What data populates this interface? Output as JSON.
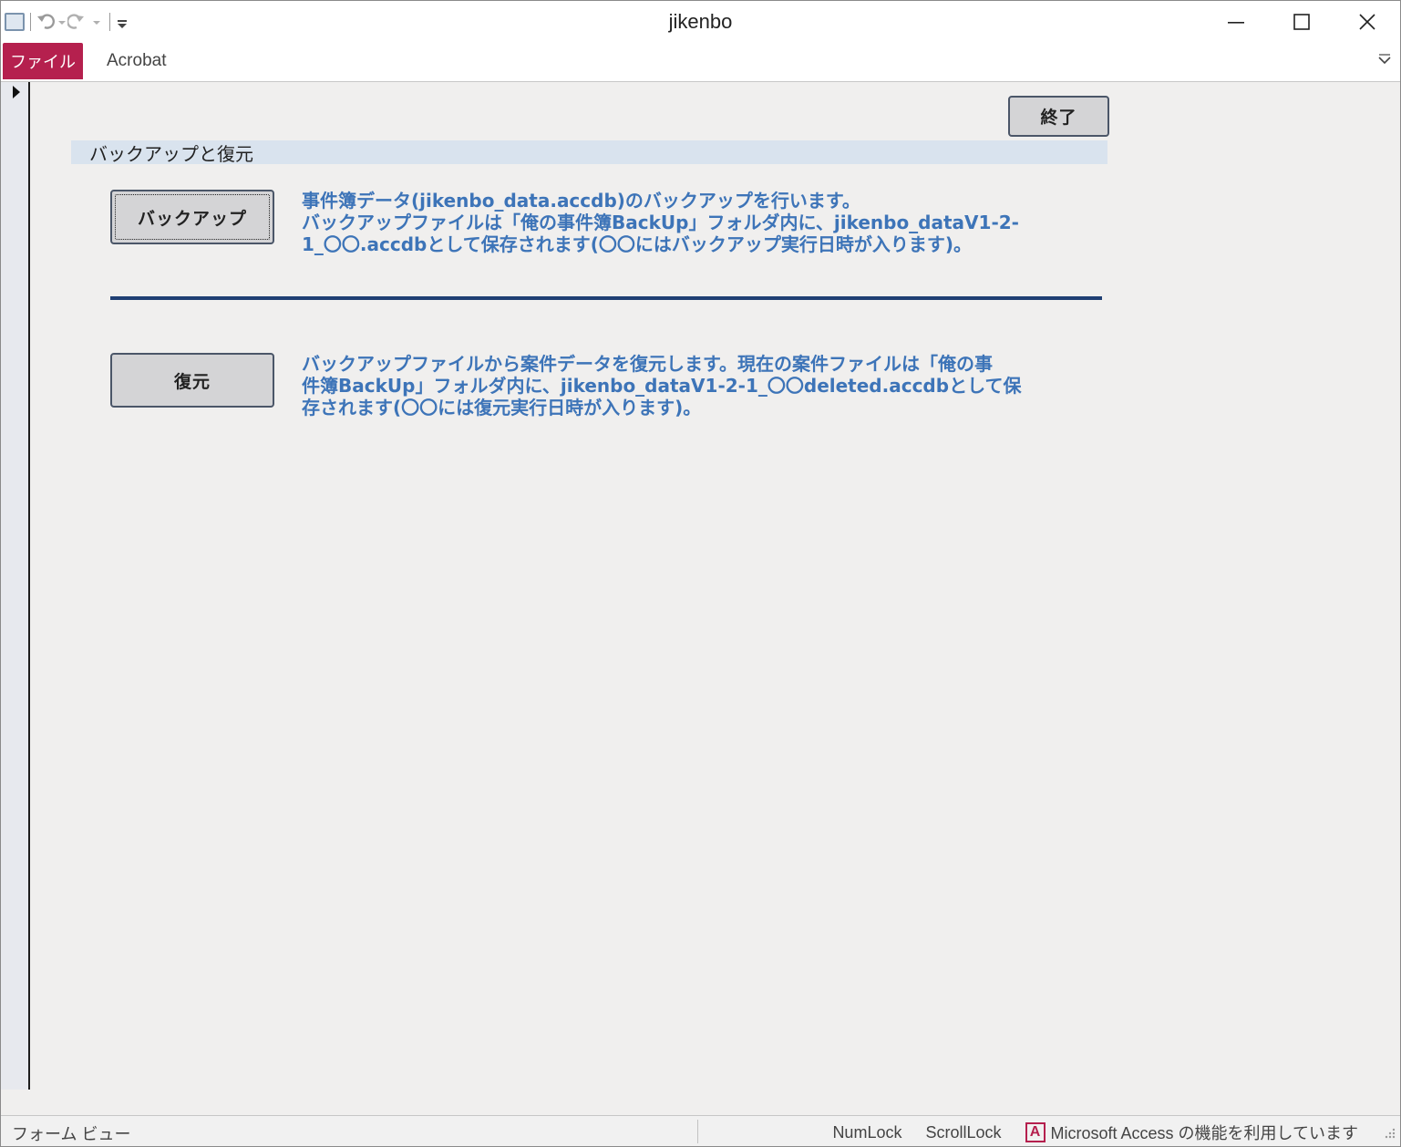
{
  "window": {
    "title": "jikenbo"
  },
  "ribbon": {
    "tabs": [
      {
        "label": "ファイル",
        "active": true
      },
      {
        "label": "Acrobat",
        "active": false
      }
    ]
  },
  "form": {
    "exit_button": "終了",
    "section_title": "バックアップと復元",
    "backup": {
      "button_label": "バックアップ",
      "description": [
        "事件簿データ(jikenbo_data.accdb)のバックアップを行います。",
        "バックアップファイルは「俺の事件簿BackUp」フォルダ内に、jikenbo_dataV1-2-",
        "1_〇〇.accdbとして保存されます(〇〇にはバックアップ実行日時が入ります)。"
      ]
    },
    "restore": {
      "button_label": "復元",
      "description": [
        "バックアップファイルから案件データを復元します。現在の案件ファイルは「俺の事",
        "件簿BackUp」フォルダ内に、jikenbo_dataV1-2-1_〇〇deleted.accdbとして保",
        "存されます(〇〇には復元実行日時が入ります)。"
      ]
    }
  },
  "statusbar": {
    "view": "フォーム ビュー",
    "numlock": "NumLock",
    "scrolllock": "ScrollLock",
    "access_notice": "Microsoft Access の機能を利用しています"
  },
  "colors": {
    "file_tab": "#b5204e",
    "description_text": "#3d74b8",
    "divider": "#1f3f73",
    "section_header_bg": "#d9e3ee"
  },
  "icons": [
    "app-icon",
    "undo-icon",
    "redo-icon",
    "customize-qat-icon",
    "minimize-icon",
    "maximize-icon",
    "close-icon",
    "ribbon-collapse-icon",
    "record-selector-arrow-icon",
    "access-logo-icon",
    "resize-grip-icon"
  ]
}
